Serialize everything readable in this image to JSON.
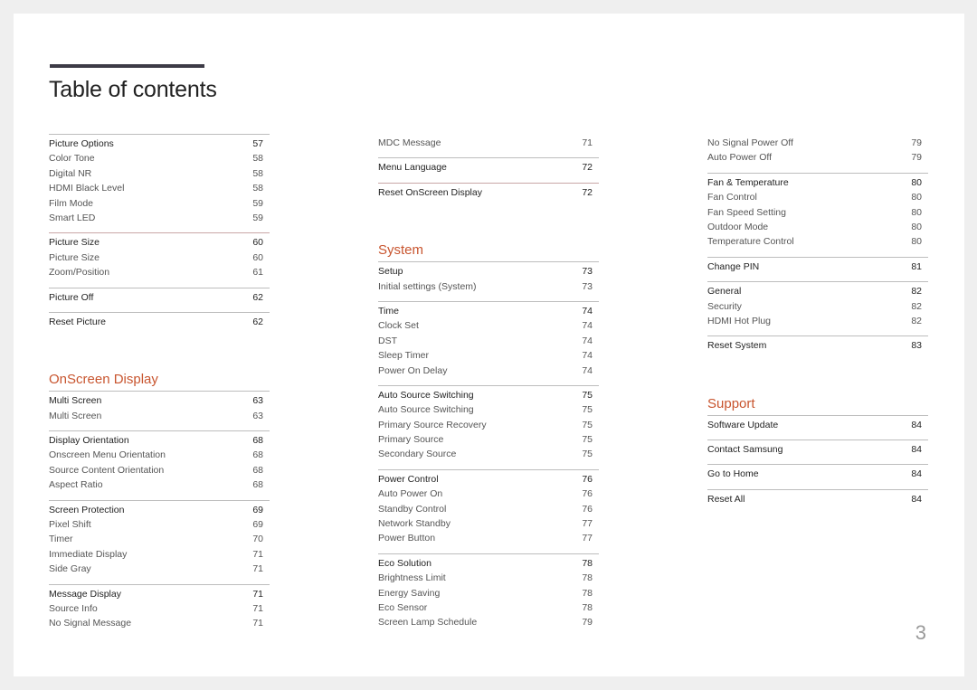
{
  "title": "Table of contents",
  "page_number": "3",
  "accent_color": "#c8552f",
  "columns": [
    {
      "blocks": [
        {
          "type": "group",
          "items": [
            {
              "label": "Picture Options",
              "page": "57",
              "head": true
            },
            {
              "label": "Color Tone",
              "page": "58"
            },
            {
              "label": "Digital NR",
              "page": "58"
            },
            {
              "label": "HDMI Black Level",
              "page": "58"
            },
            {
              "label": "Film Mode",
              "page": "59"
            },
            {
              "label": "Smart LED",
              "page": "59"
            }
          ]
        },
        {
          "type": "group",
          "pink": true,
          "items": [
            {
              "label": "Picture Size",
              "page": "60",
              "head": true
            },
            {
              "label": "Picture Size",
              "page": "60"
            },
            {
              "label": "Zoom/Position",
              "page": "61"
            }
          ]
        },
        {
          "type": "group",
          "items": [
            {
              "label": "Picture Off",
              "page": "62",
              "head": true
            }
          ]
        },
        {
          "type": "group",
          "items": [
            {
              "label": "Reset Picture",
              "page": "62",
              "head": true
            }
          ]
        },
        {
          "type": "section",
          "title": "OnScreen Display"
        },
        {
          "type": "group",
          "items": [
            {
              "label": "Multi Screen",
              "page": "63",
              "head": true
            },
            {
              "label": "Multi Screen",
              "page": "63"
            }
          ]
        },
        {
          "type": "group",
          "items": [
            {
              "label": "Display Orientation",
              "page": "68",
              "head": true
            },
            {
              "label": "Onscreen Menu Orientation",
              "page": "68"
            },
            {
              "label": "Source Content Orientation",
              "page": "68"
            },
            {
              "label": "Aspect Ratio",
              "page": "68"
            }
          ]
        },
        {
          "type": "group",
          "items": [
            {
              "label": "Screen Protection",
              "page": "69",
              "head": true
            },
            {
              "label": "Pixel Shift",
              "page": "69"
            },
            {
              "label": "Timer",
              "page": "70"
            },
            {
              "label": "Immediate Display",
              "page": "71"
            },
            {
              "label": "Side Gray",
              "page": "71"
            }
          ]
        },
        {
          "type": "group",
          "items": [
            {
              "label": "Message Display",
              "page": "71",
              "head": true
            },
            {
              "label": "Source Info",
              "page": "71"
            },
            {
              "label": "No Signal Message",
              "page": "71"
            }
          ]
        }
      ]
    },
    {
      "blocks": [
        {
          "type": "group",
          "noborder": true,
          "items": [
            {
              "label": "MDC Message",
              "page": "71"
            }
          ]
        },
        {
          "type": "group",
          "items": [
            {
              "label": "Menu Language",
              "page": "72",
              "head": true
            }
          ]
        },
        {
          "type": "group",
          "pink": true,
          "items": [
            {
              "label": "Reset OnScreen Display",
              "page": "72",
              "head": true
            }
          ]
        },
        {
          "type": "section",
          "title": "System"
        },
        {
          "type": "group",
          "items": [
            {
              "label": "Setup",
              "page": "73",
              "head": true
            },
            {
              "label": "Initial settings (System)",
              "page": "73"
            }
          ]
        },
        {
          "type": "group",
          "items": [
            {
              "label": "Time",
              "page": "74",
              "head": true
            },
            {
              "label": "Clock Set",
              "page": "74"
            },
            {
              "label": "DST",
              "page": "74"
            },
            {
              "label": "Sleep Timer",
              "page": "74"
            },
            {
              "label": "Power On Delay",
              "page": "74"
            }
          ]
        },
        {
          "type": "group",
          "items": [
            {
              "label": "Auto Source Switching",
              "page": "75",
              "head": true
            },
            {
              "label": "Auto Source Switching",
              "page": "75"
            },
            {
              "label": "Primary Source Recovery",
              "page": "75"
            },
            {
              "label": "Primary Source",
              "page": "75"
            },
            {
              "label": "Secondary Source",
              "page": "75"
            }
          ]
        },
        {
          "type": "group",
          "items": [
            {
              "label": "Power Control",
              "page": "76",
              "head": true
            },
            {
              "label": "Auto Power On",
              "page": "76"
            },
            {
              "label": "Standby Control",
              "page": "76"
            },
            {
              "label": "Network Standby",
              "page": "77"
            },
            {
              "label": "Power Button",
              "page": "77"
            }
          ]
        },
        {
          "type": "group",
          "items": [
            {
              "label": "Eco Solution",
              "page": "78",
              "head": true
            },
            {
              "label": "Brightness Limit",
              "page": "78"
            },
            {
              "label": "Energy Saving",
              "page": "78"
            },
            {
              "label": "Eco Sensor",
              "page": "78"
            },
            {
              "label": "Screen Lamp Schedule",
              "page": "79"
            }
          ]
        }
      ]
    },
    {
      "blocks": [
        {
          "type": "group",
          "noborder": true,
          "items": [
            {
              "label": "No Signal Power Off",
              "page": "79"
            },
            {
              "label": "Auto Power Off",
              "page": "79"
            }
          ]
        },
        {
          "type": "group",
          "items": [
            {
              "label": "Fan & Temperature",
              "page": "80",
              "head": true
            },
            {
              "label": "Fan Control",
              "page": "80"
            },
            {
              "label": "Fan Speed Setting",
              "page": "80"
            },
            {
              "label": "Outdoor Mode",
              "page": "80"
            },
            {
              "label": "Temperature Control",
              "page": "80"
            }
          ]
        },
        {
          "type": "group",
          "items": [
            {
              "label": "Change PIN",
              "page": "81",
              "head": true
            }
          ]
        },
        {
          "type": "group",
          "items": [
            {
              "label": "General",
              "page": "82",
              "head": true
            },
            {
              "label": "Security",
              "page": "82"
            },
            {
              "label": "HDMI Hot Plug",
              "page": "82"
            }
          ]
        },
        {
          "type": "group",
          "items": [
            {
              "label": "Reset System",
              "page": "83",
              "head": true
            }
          ]
        },
        {
          "type": "section",
          "title": "Support"
        },
        {
          "type": "group",
          "items": [
            {
              "label": "Software Update",
              "page": "84",
              "head": true
            }
          ]
        },
        {
          "type": "group",
          "items": [
            {
              "label": "Contact Samsung",
              "page": "84",
              "head": true
            }
          ]
        },
        {
          "type": "group",
          "items": [
            {
              "label": "Go to Home",
              "page": "84",
              "head": true
            }
          ]
        },
        {
          "type": "group",
          "items": [
            {
              "label": "Reset All",
              "page": "84",
              "head": true
            }
          ]
        }
      ]
    }
  ]
}
